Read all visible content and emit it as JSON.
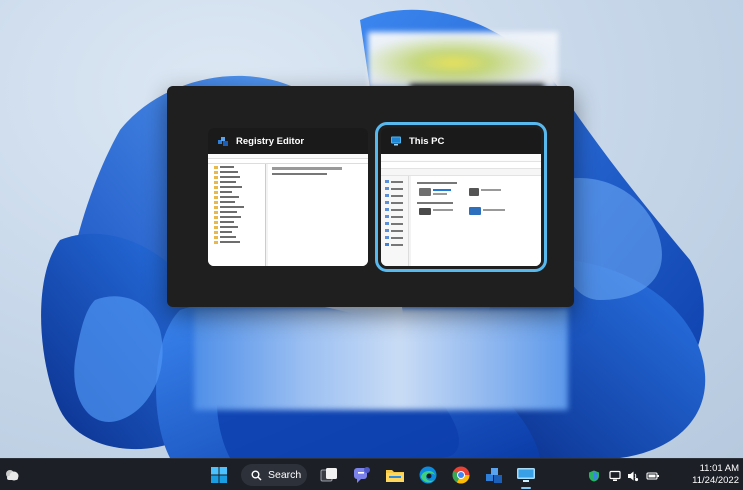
{
  "switcher": {
    "windows": [
      {
        "title": "Registry Editor",
        "icon": "registry-editor-icon",
        "selected": false
      },
      {
        "title": "This PC",
        "icon": "this-pc-icon",
        "selected": true
      }
    ]
  },
  "taskbar": {
    "search_label": "Search",
    "apps": [
      "widgets-icon",
      "start-icon",
      "task-view-icon",
      "teams-chat-icon",
      "file-explorer-icon",
      "edge-icon",
      "chrome-icon",
      "registry-editor-icon",
      "this-pc-icon"
    ],
    "tray": [
      "security-icon",
      "network-icon",
      "volume-icon",
      "battery-icon"
    ],
    "time": "11:01 AM",
    "date": "11/24/2022"
  },
  "colors": {
    "switcher_bg": "#1f1f1f",
    "selection_accent": "#58b9ee",
    "taskbar_bg": "#1c1f26",
    "wallpaper_blue": "#1d5fd6"
  }
}
